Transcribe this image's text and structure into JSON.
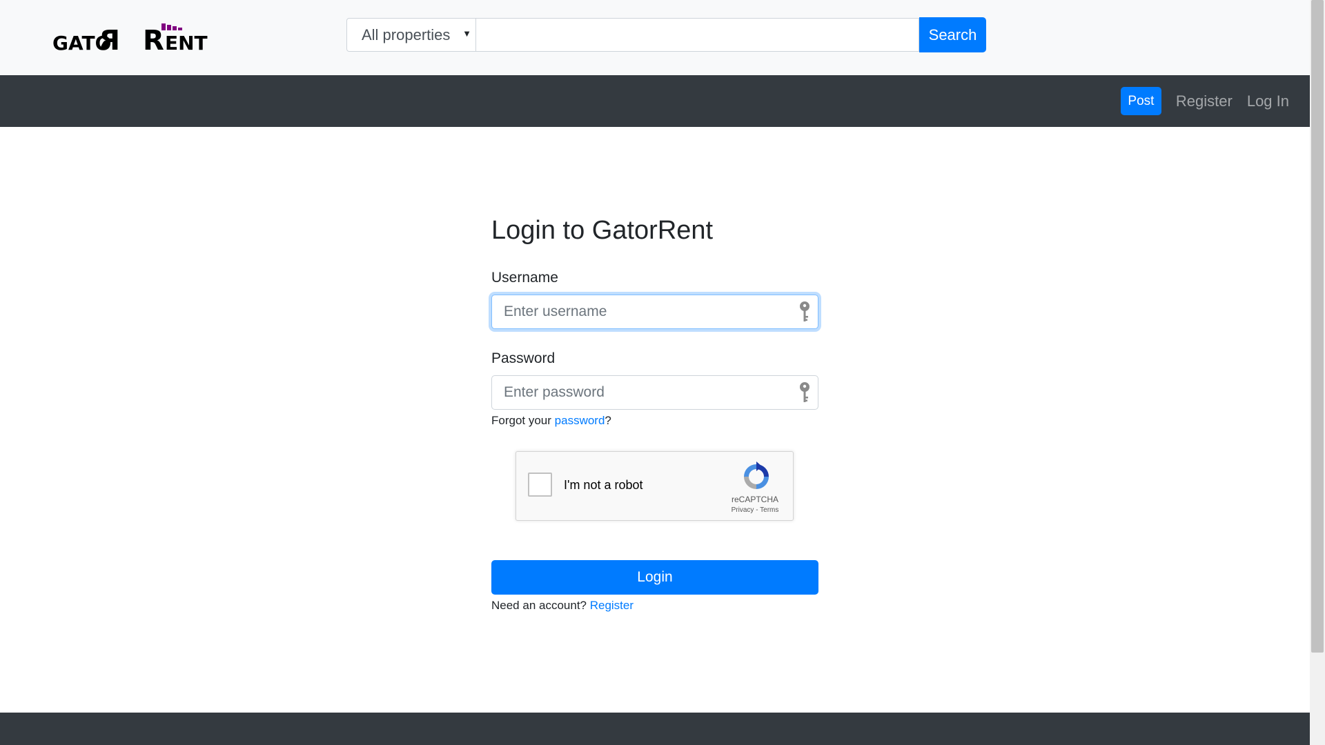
{
  "brand": {
    "logo_letters": [
      "GATO",
      "R",
      "R",
      "ENT"
    ],
    "logo_accent_color": "#800080"
  },
  "search": {
    "category_selected": "All properties",
    "query_value": "",
    "button_label": "Search"
  },
  "nav": {
    "post_label": "Post",
    "register_label": "Register",
    "login_label": "Log In"
  },
  "login_form": {
    "title": "Login to GatorRent",
    "username_label": "Username",
    "username_placeholder": "Enter username",
    "password_label": "Password",
    "password_placeholder": "Enter password",
    "forgot_prefix": "Forgot your ",
    "forgot_link": "password",
    "forgot_suffix": "?",
    "submit_label": "Login",
    "account_prompt": "Need an account? ",
    "register_link": "Register"
  },
  "recaptcha": {
    "checkbox_label": "I'm not a robot",
    "brand": "reCAPTCHA",
    "privacy_label": "Privacy",
    "separator": " - ",
    "terms_label": "Terms"
  },
  "colors": {
    "primary": "#007bff",
    "navbar_dark": "#343a40",
    "topbar_light": "#f8f9fa"
  }
}
